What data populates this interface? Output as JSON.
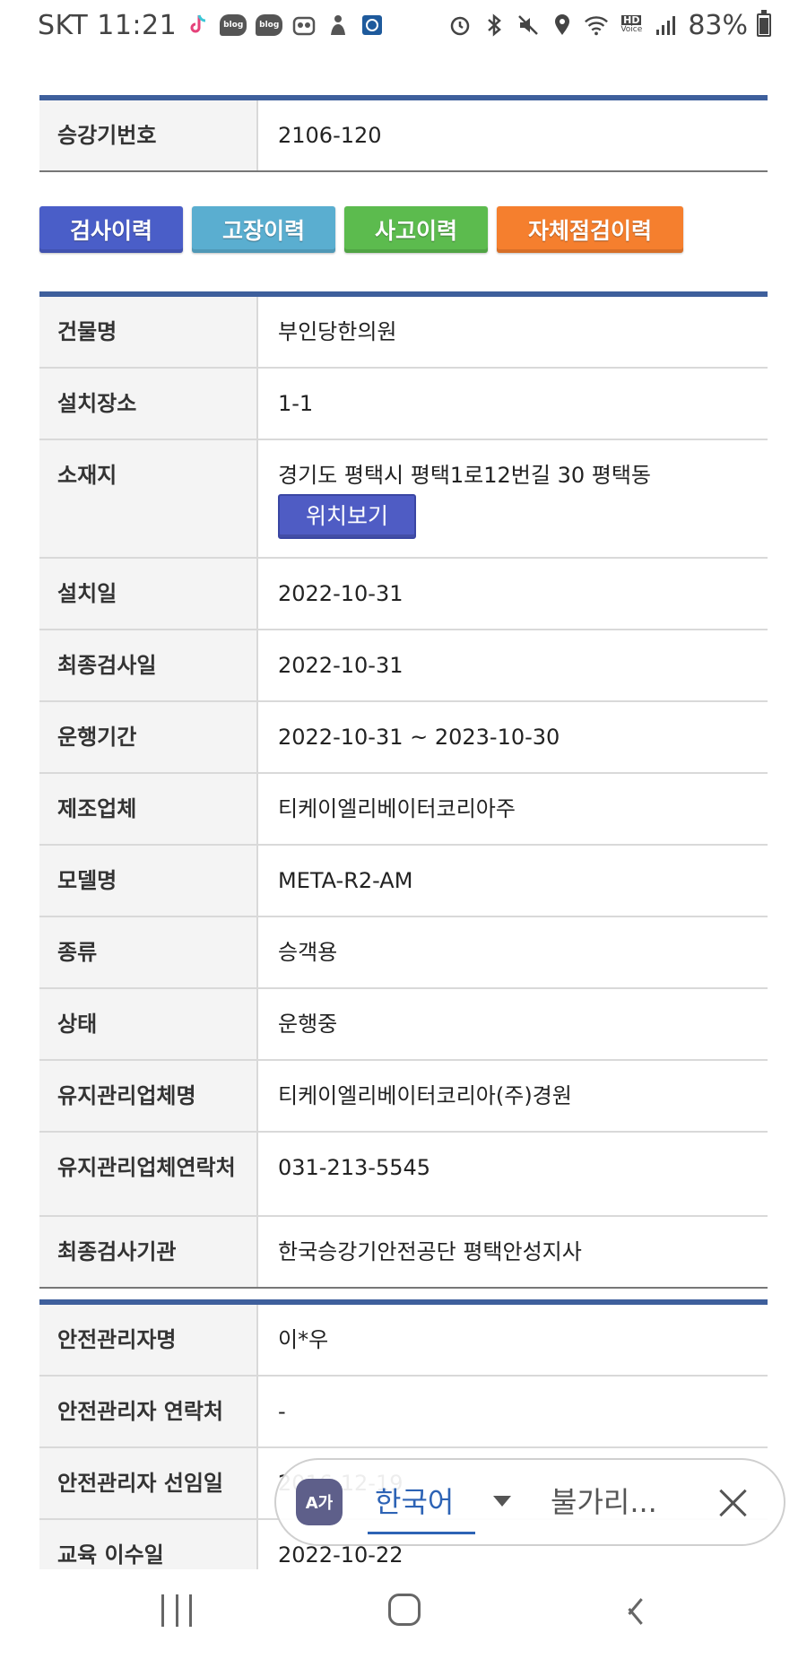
{
  "status_bar": {
    "time": "SKT 11:21",
    "battery_text": "83%",
    "battery_level": 0.83,
    "notification_icons": [
      "tiktok-icon",
      "blog-icon",
      "blog-icon",
      "owl-icon",
      "figure-icon",
      "app-icon"
    ],
    "system_icons": [
      "alarm-icon",
      "bluetooth-icon",
      "mute-icon",
      "location-icon",
      "wifi-icon",
      "hd-voice-icon",
      "signal-icon",
      "battery-icon"
    ],
    "blog_label": "blog",
    "hd_label": "HD",
    "voice_label": "Voice"
  },
  "elevator_number": {
    "label": "승강기번호",
    "value": "2106-120"
  },
  "history_buttons": [
    {
      "label": "검사이력",
      "color": "#4a5ec8"
    },
    {
      "label": "고장이력",
      "color": "#5aaed0"
    },
    {
      "label": "사고이력",
      "color": "#5cbb4e"
    },
    {
      "label": "자체점검이력",
      "color": "#f57f2e"
    }
  ],
  "details": {
    "building_name": {
      "label": "건물명",
      "value": "부인당한의원"
    },
    "install_place": {
      "label": "설치장소",
      "value": "1-1"
    },
    "address": {
      "label": "소재지",
      "value": "경기도 평택시 평택1로12번길 30 평택동",
      "button": "위치보기"
    },
    "install_date": {
      "label": "설치일",
      "value": "2022-10-31"
    },
    "last_inspection_date": {
      "label": "최종검사일",
      "value": "2022-10-31"
    },
    "operation_period": {
      "label": "운행기간",
      "value": "2022-10-31 ~ 2023-10-30"
    },
    "manufacturer": {
      "label": "제조업체",
      "value": "티케이엘리베이터코리아주"
    },
    "model": {
      "label": "모델명",
      "value": "META-R2-AM"
    },
    "type": {
      "label": "종류",
      "value": "승객용"
    },
    "status": {
      "label": "상태",
      "value": "운행중"
    },
    "maintenance_company": {
      "label": "유지관리업체명",
      "value": "티케이엘리베이터코리아(주)경원"
    },
    "maintenance_contact": {
      "label": "유지관리업체연락처",
      "value": "031-213-5545"
    },
    "inspection_agency": {
      "label": "최종검사기관",
      "value": "한국승강기안전공단 평택안성지사"
    }
  },
  "safety": {
    "manager_name": {
      "label": "안전관리자명",
      "value": "이*우"
    },
    "manager_contact": {
      "label": "안전관리자 연락처",
      "value": "-"
    },
    "appointment_date": {
      "label": "안전관리자 선임일",
      "value": "2016-12-19"
    },
    "training_date": {
      "label": "교육 이수일",
      "value": "2022-10-22"
    }
  },
  "translate_bar": {
    "icon_text": "A가",
    "source_language": "한국어",
    "target_language": "불가리..."
  },
  "nav": {
    "recent": "recent-apps-icon",
    "home": "home-icon",
    "back": "back-icon"
  }
}
